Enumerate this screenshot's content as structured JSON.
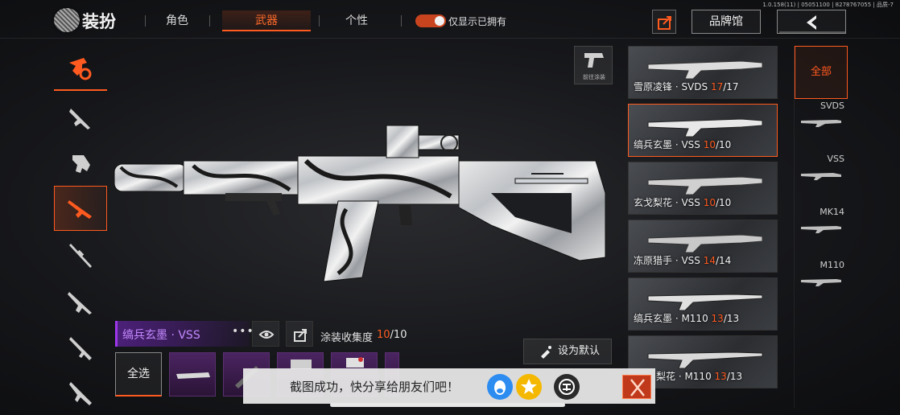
{
  "version_info": "1.0.158(11) | 05051100 | 8278767055 | 品质-7",
  "header": {
    "title": "装扮",
    "tabs": [
      {
        "label": "角色",
        "active": false
      },
      {
        "label": "武器",
        "active": true
      },
      {
        "label": "个性",
        "active": false
      }
    ],
    "toggle_label": "仅显示已拥有",
    "toggle_on": true,
    "brand_button": "品牌馆",
    "share_icon": "share-icon",
    "back_icon": "back-arrow-icon"
  },
  "categories": [
    {
      "icon": "weapon-skin-category-icon",
      "active": false
    },
    {
      "icon": "rifle-icon",
      "active": false
    },
    {
      "icon": "smg-icon",
      "active": false
    },
    {
      "icon": "marksman-rifle-icon",
      "active": true
    },
    {
      "icon": "sniper-rifle-icon",
      "active": false
    },
    {
      "icon": "assault-rifle-icon",
      "active": false
    },
    {
      "icon": "shotgun-icon",
      "active": false
    },
    {
      "icon": "carbine-icon",
      "active": false
    }
  ],
  "goto_skin": {
    "label": "前往涂装"
  },
  "current_skin": {
    "name": "缟兵玄墨 · VSS",
    "collect_label": "涂装收集度",
    "collect_current": "10",
    "collect_total": "/10"
  },
  "bottom": {
    "select_all": "全选",
    "set_default": "设为默认"
  },
  "skins": [
    {
      "name": "雪原凌锋 · SVDS ",
      "cur": "17",
      "total": "/17",
      "active": false
    },
    {
      "name": "缟兵玄墨 · VSS ",
      "cur": "10",
      "total": "/10",
      "active": true
    },
    {
      "name": "玄戈梨花 · VSS ",
      "cur": "10",
      "total": "/10",
      "active": false
    },
    {
      "name": "冻原猎手 · VSS ",
      "cur": "14",
      "total": "/14",
      "active": false
    },
    {
      "name": "缟兵玄墨 · M110 ",
      "cur": "13",
      "total": "/13",
      "active": false
    },
    {
      "name": "梨花 · M110 ",
      "cur": "13",
      "total": "/13",
      "active": false
    }
  ],
  "filters": {
    "all": "全部",
    "items": [
      "SVDS",
      "VSS",
      "MK14",
      "M110"
    ]
  },
  "toast": {
    "text": "截图成功，快分享给朋友们吧！",
    "close_icon": "close-x-icon"
  },
  "colors": {
    "accent": "#ff5a1f",
    "rarity_purple": "#9c37e8",
    "background": "#16171a"
  }
}
